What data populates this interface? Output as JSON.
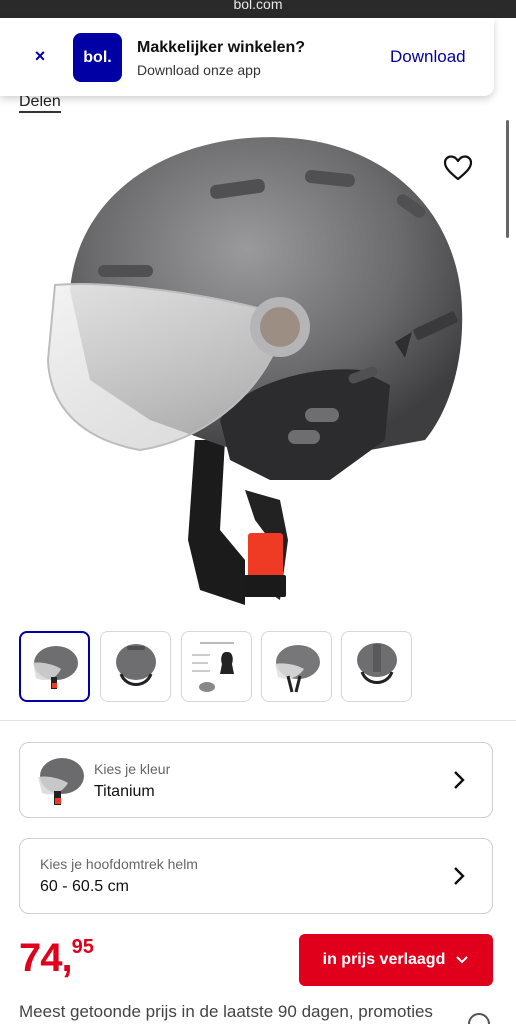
{
  "browser": {
    "url": "bol.com"
  },
  "app_banner": {
    "close": "×",
    "logo_text": "bol.",
    "title": "Makkelijker winkelen?",
    "subtitle": "Download onze app",
    "download_label": "Download"
  },
  "share_label": "Delen",
  "gallery": {
    "thumbnail_count": 5,
    "active_index": 0
  },
  "selectors": [
    {
      "label": "Kies je kleur",
      "value": "Titanium"
    },
    {
      "label": "Kies je hoofdomtrek helm",
      "value": "60 - 60.5 cm"
    }
  ],
  "price": {
    "main": "74,",
    "cents": "95",
    "color": "#e0001b"
  },
  "badge": {
    "label": "in prijs verlaagd"
  },
  "footnote": "Meest getoonde prijs in de laatste 90 dagen, promoties",
  "colors": {
    "brand": "#0000a4",
    "price_red": "#e0001b"
  }
}
